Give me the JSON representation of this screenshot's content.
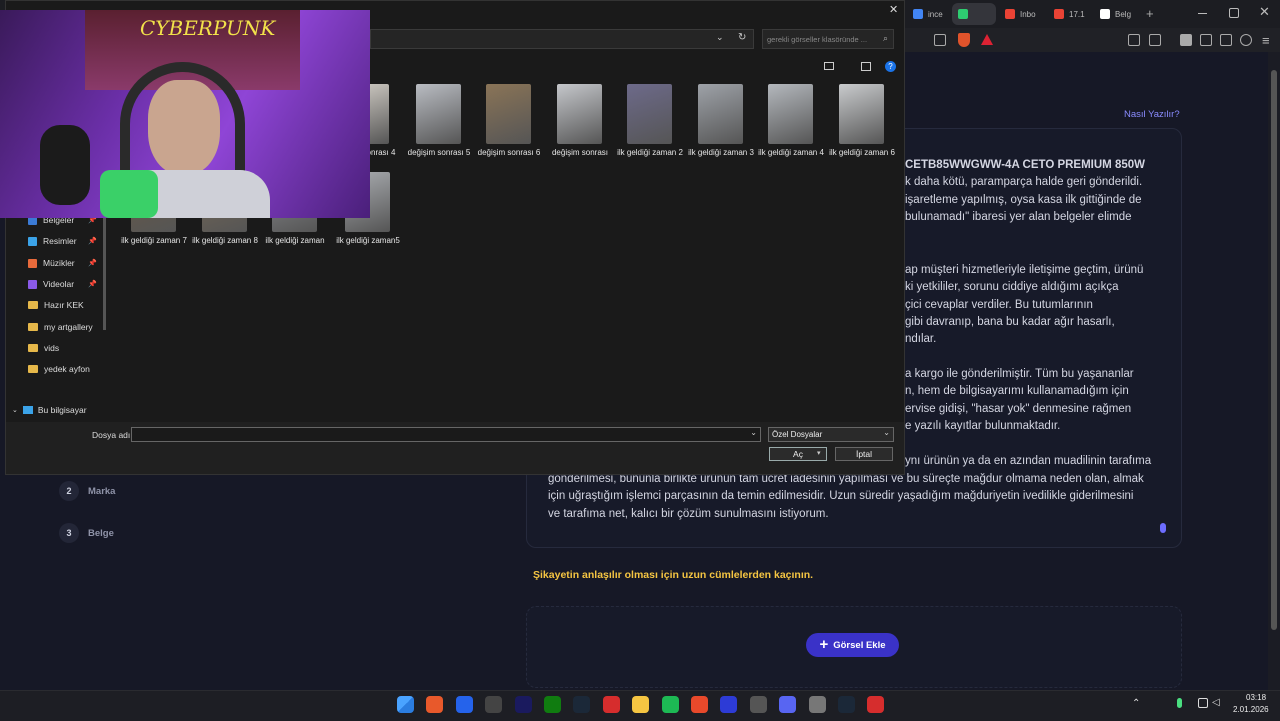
{
  "browser": {
    "tabs": [
      {
        "label": "ince",
        "color": "#4285f4"
      },
      {
        "label": "",
        "color": "#2ecc71"
      },
      {
        "label": "Inbo",
        "color": "#ea4335"
      },
      {
        "label": "17.1",
        "color": "#ea4335"
      },
      {
        "label": "Belg",
        "color": "#ffffff"
      }
    ],
    "new_tab": "+"
  },
  "page": {
    "help_link": "Nasıl Yazılır?",
    "complaint_lines": [
      "CETB85WWGWW-4A CETO PREMIUM 850W",
      "k daha kötü, paramparça halde geri gönderildi.",
      "işaretleme yapılmış, oysa kasa ilk gittiğinde de",
      "bulunamadı\" ibaresi yer alan belgeler elimde",
      "",
      "ap müşteri hizmetleriyle iletişime geçtim, ürünü",
      "ki yetkililer, sorunu ciddiye aldığımı açıkça",
      "çici cevaplar verdiler. Bu tutumlarının",
      "gibi davranıp, bana bu kadar ağır hasarlı,",
      "ndılar.",
      "",
      "a kargo ile gönderilmiştir. Tüm bu yaşananlar",
      "n, hem de bilgisayarımı kullanamadığım için",
      "ervise gidişi, \"hasar yok\" denmesine rağmen",
      "e yazılı kayıtlar bulunmaktadır.",
      "",
      "ynı ürünün ya da en azından muadilinin tarafıma",
      "gönderilmesi, bununla birlikte ürünün tam ücret iadesinin yapılması ve bu süreçte mağdur olmama neden olan, almak",
      "için uğraştığım işlemci parçasının da temin edilmesidir. Uzun süredir yaşadığım mağduriyetin ivedilikle giderilmesini",
      "ve tarafıma net, kalıcı bir çözüm sunulmasını istiyorum."
    ],
    "steps": [
      {
        "num": "2",
        "label": "Marka"
      },
      {
        "num": "3",
        "label": "Belge"
      }
    ],
    "warning": "Şikayetin anlaşılır olması için uzun cümlelerden kaçının.",
    "add_image": "Görsel Ekle"
  },
  "dialog": {
    "search_placeholder": "gerekli görseller klasöründe ...",
    "files": [
      {
        "label": "sonrası 4",
        "color": "#c8c4bd"
      },
      {
        "label": "değişim sonrası 5",
        "color": "#b9bcc2"
      },
      {
        "label": "değişim sonrası 6",
        "color": "#8a7457"
      },
      {
        "label": "değişim sonrası",
        "color": "#c5c7cb"
      },
      {
        "label": "ilk geldiği zaman 2",
        "color": "#6d6a8a"
      },
      {
        "label": "ilk geldiği zaman 3",
        "color": "#9ea2a8"
      },
      {
        "label": "ilk geldiği zaman 4",
        "color": "#b4b8bd"
      },
      {
        "label": "ilk geldiği zaman 6",
        "color": "#c9cbcd"
      },
      {
        "label": "ilk geldiği zaman 7",
        "color": "#6b5a44"
      },
      {
        "label": "ilk geldiği zaman 8",
        "color": "#7a6a55"
      },
      {
        "label": "ilk geldiği zaman",
        "color": "#8d8f93"
      },
      {
        "label": "ilk geldiği zaman5",
        "color": "#aaadb1"
      }
    ],
    "nav": [
      {
        "label": "Belgeler",
        "pinned": true
      },
      {
        "label": "Resimler",
        "pinned": true
      },
      {
        "label": "Müzikler",
        "pinned": true
      },
      {
        "label": "Videolar",
        "pinned": true
      },
      {
        "label": "Hazır KEK",
        "pinned": false
      },
      {
        "label": "my artgallery",
        "pinned": false
      },
      {
        "label": "vids",
        "pinned": false
      },
      {
        "label": "yedek ayfon",
        "pinned": false
      }
    ],
    "this_pc": "Bu bilgisayar",
    "filename_label": "Dosya adı:",
    "filename_value": "",
    "filter": "Özel Dosyalar",
    "open": "Aç",
    "cancel": "İptal"
  },
  "webcam": {
    "poster_text": "CYBERPUNK"
  },
  "taskbar": {
    "time": "03:18",
    "date": "2.01.2026",
    "apps": [
      "windows-icon",
      "browser-orange-icon",
      "monitor-icon",
      "epic-icon",
      "premiere-icon",
      "xbox-icon",
      "steam-icon",
      "red-app-icon",
      "files-icon",
      "spotify-icon",
      "brave-icon",
      "obs-icon",
      "settings-icon",
      "discord-icon",
      "gear-icon",
      "steam2-icon",
      "acrobat-icon"
    ]
  }
}
